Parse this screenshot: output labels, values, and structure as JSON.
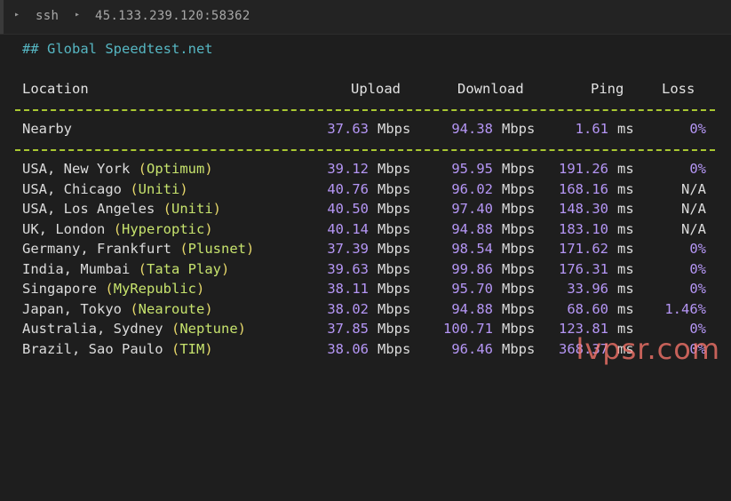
{
  "titlebar": {
    "crumbs": [
      "ssh",
      "45.133.239.120:58362"
    ]
  },
  "terminal": {
    "heading": "## Global Speedtest.net",
    "columns": {
      "location": "Location",
      "upload": "Upload",
      "download": "Download",
      "ping": "Ping",
      "loss": "Loss"
    },
    "nearby": {
      "name": "Nearby",
      "upload": "37.63",
      "upload_unit": "Mbps",
      "download": "94.38",
      "download_unit": "Mbps",
      "ping": "1.61",
      "ping_unit": "ms",
      "loss": "0%"
    },
    "rows": [
      {
        "place": "USA, New York",
        "isp": "Optimum",
        "upload": "39.12",
        "upload_unit": "Mbps",
        "download": "95.95",
        "download_unit": "Mbps",
        "ping": "191.26",
        "ping_unit": "ms",
        "loss": "0%"
      },
      {
        "place": "USA, Chicago",
        "isp": "Uniti",
        "upload": "40.76",
        "upload_unit": "Mbps",
        "download": "96.02",
        "download_unit": "Mbps",
        "ping": "168.16",
        "ping_unit": "ms",
        "loss": "N/A"
      },
      {
        "place": "USA, Los Angeles",
        "isp": "Uniti",
        "upload": "40.50",
        "upload_unit": "Mbps",
        "download": "97.40",
        "download_unit": "Mbps",
        "ping": "148.30",
        "ping_unit": "ms",
        "loss": "N/A"
      },
      {
        "place": "UK, London",
        "isp": "Hyperoptic",
        "upload": "40.14",
        "upload_unit": "Mbps",
        "download": "94.88",
        "download_unit": "Mbps",
        "ping": "183.10",
        "ping_unit": "ms",
        "loss": "N/A"
      },
      {
        "place": "Germany, Frankfurt",
        "isp": "Plusnet",
        "upload": "37.39",
        "upload_unit": "Mbps",
        "download": "98.54",
        "download_unit": "Mbps",
        "ping": "171.62",
        "ping_unit": "ms",
        "loss": "0%"
      },
      {
        "place": "India, Mumbai",
        "isp": "Tata Play",
        "upload": "39.63",
        "upload_unit": "Mbps",
        "download": "99.86",
        "download_unit": "Mbps",
        "ping": "176.31",
        "ping_unit": "ms",
        "loss": "0%"
      },
      {
        "place": "Singapore",
        "isp": "MyRepublic",
        "upload": "38.11",
        "upload_unit": "Mbps",
        "download": "95.70",
        "download_unit": "Mbps",
        "ping": "33.96",
        "ping_unit": "ms",
        "loss": "0%"
      },
      {
        "place": "Japan, Tokyo",
        "isp": "Nearoute",
        "upload": "38.02",
        "upload_unit": "Mbps",
        "download": "94.88",
        "download_unit": "Mbps",
        "ping": "68.60",
        "ping_unit": "ms",
        "loss": "1.46%"
      },
      {
        "place": "Australia, Sydney",
        "isp": "Neptune",
        "upload": "37.85",
        "upload_unit": "Mbps",
        "download": "100.71",
        "download_unit": "Mbps",
        "ping": "123.81",
        "ping_unit": "ms",
        "loss": "0%"
      },
      {
        "place": "Brazil, Sao Paulo",
        "isp": "TIM",
        "upload": "38.06",
        "upload_unit": "Mbps",
        "download": "96.46",
        "download_unit": "Mbps",
        "ping": "368.37",
        "ping_unit": "ms",
        "loss": "0%"
      }
    ]
  },
  "watermark": "lvpsr.com"
}
